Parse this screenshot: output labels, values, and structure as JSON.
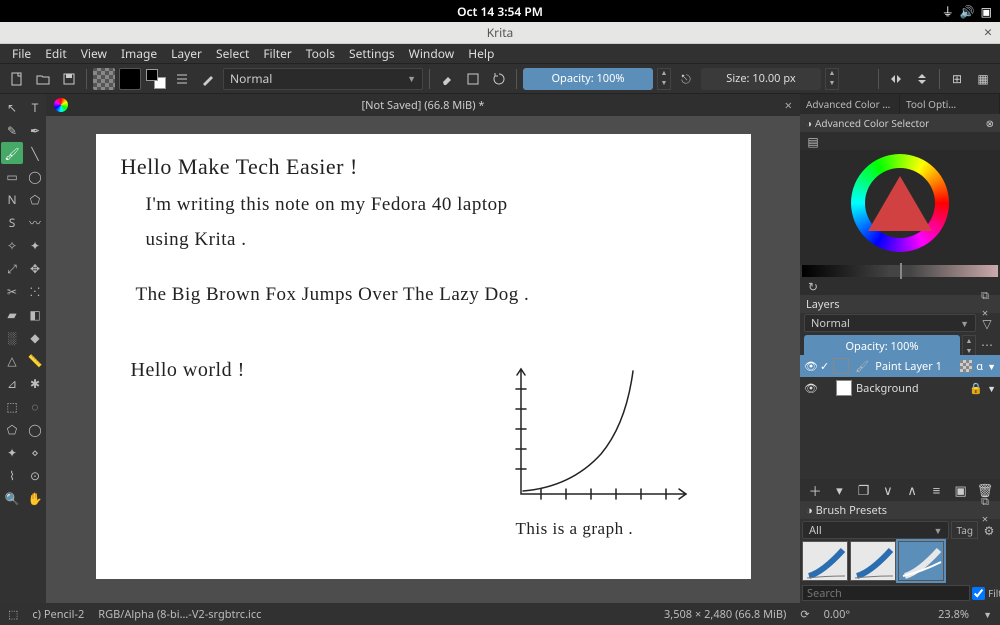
{
  "sysbar": {
    "datetime": "Oct 14   3:54 PM"
  },
  "window": {
    "title": "Krita"
  },
  "menu": [
    "File",
    "Edit",
    "View",
    "Image",
    "Layer",
    "Select",
    "Filter",
    "Tools",
    "Settings",
    "Window",
    "Help"
  ],
  "toolbar": {
    "blend_mode": "Normal",
    "opacity_label": "Opacity: 100%",
    "size_label": "Size: 10.00 px"
  },
  "doc_tab": {
    "title": "[Not Saved]  (66.8 MiB) *"
  },
  "handwriting": {
    "line1": "Hello Make Tech Easier !",
    "line2": "I'm writing this note on my Fedora 40 laptop",
    "line3": "using Krita .",
    "line4": "The Big Brown Fox Jumps Over The Lazy Dog .",
    "line5": "Hello world !",
    "graph_caption": "This is a graph ."
  },
  "right": {
    "tab1": "Advanced Color Selec…",
    "tab2": "Tool Opti…",
    "color_title": "Advanced Color Selector",
    "layers_title": "Layers",
    "layers_blend": "Normal",
    "layers_opacity": "Opacity:  100%",
    "layer1": "Paint Layer 1",
    "layer2": "Background",
    "presets_title": "Brush Presets",
    "preset_tag": "All",
    "tag_label": "Tag",
    "search_placeholder": "Search",
    "filter_label": "Filter in Tag"
  },
  "status": {
    "brush": "c) Pencil-2",
    "profile": "RGB/Alpha (8-bi…-V2-srgbtrc.icc",
    "dims": "3,508 × 2,480 (66.8 MiB)",
    "angle": "0.00°",
    "zoom": "23.8%"
  }
}
